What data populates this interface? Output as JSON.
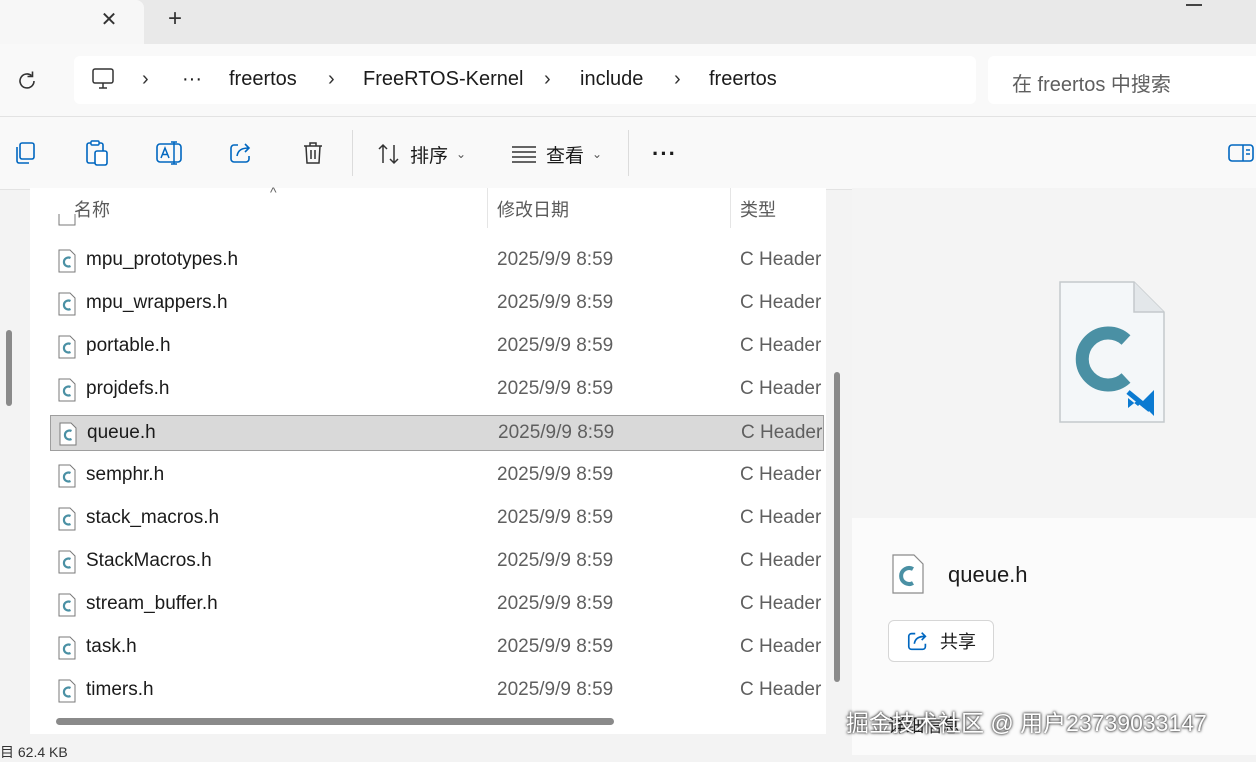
{
  "tabs": {
    "close_glyph": "✕",
    "new_glyph": "+"
  },
  "breadcrumb": {
    "more": "···",
    "items": [
      "freertos",
      "FreeRTOS-Kernel",
      "include",
      "freertos"
    ]
  },
  "search": {
    "placeholder": "在 freertos 中搜索"
  },
  "toolbar": {
    "sort_label": "排序",
    "view_label": "查看",
    "more_label": "···",
    "icons": [
      "copy-icon",
      "paste-icon",
      "rename-icon",
      "share-icon",
      "delete-icon"
    ]
  },
  "columns": {
    "name": "名称",
    "modified": "修改日期",
    "type": "类型"
  },
  "files": [
    {
      "name": "mpu_prototypes.h",
      "modified": "2025/9/9 8:59",
      "type": "C Header",
      "selected": false
    },
    {
      "name": "mpu_wrappers.h",
      "modified": "2025/9/9 8:59",
      "type": "C Header",
      "selected": false
    },
    {
      "name": "portable.h",
      "modified": "2025/9/9 8:59",
      "type": "C Header",
      "selected": false
    },
    {
      "name": "projdefs.h",
      "modified": "2025/9/9 8:59",
      "type": "C Header",
      "selected": false
    },
    {
      "name": "queue.h",
      "modified": "2025/9/9 8:59",
      "type": "C Header",
      "selected": true
    },
    {
      "name": "semphr.h",
      "modified": "2025/9/9 8:59",
      "type": "C Header",
      "selected": false
    },
    {
      "name": "stack_macros.h",
      "modified": "2025/9/9 8:59",
      "type": "C Header",
      "selected": false
    },
    {
      "name": "StackMacros.h",
      "modified": "2025/9/9 8:59",
      "type": "C Header",
      "selected": false
    },
    {
      "name": "stream_buffer.h",
      "modified": "2025/9/9 8:59",
      "type": "C Header",
      "selected": false
    },
    {
      "name": "task.h",
      "modified": "2025/9/9 8:59",
      "type": "C Header",
      "selected": false
    },
    {
      "name": "timers.h",
      "modified": "2025/9/9 8:59",
      "type": "C Header",
      "selected": false
    }
  ],
  "details": {
    "file_name": "queue.h",
    "share_label": "共享",
    "section_label": "详细信息"
  },
  "status": {
    "text": "目 62.4 KB"
  },
  "watermark": "掘金技术社区 @ 用户23739033147",
  "colors": {
    "selected_row": "#d9d9d9",
    "c_icon": "#4a90a4",
    "vscode_blue": "#0b7ad1"
  }
}
